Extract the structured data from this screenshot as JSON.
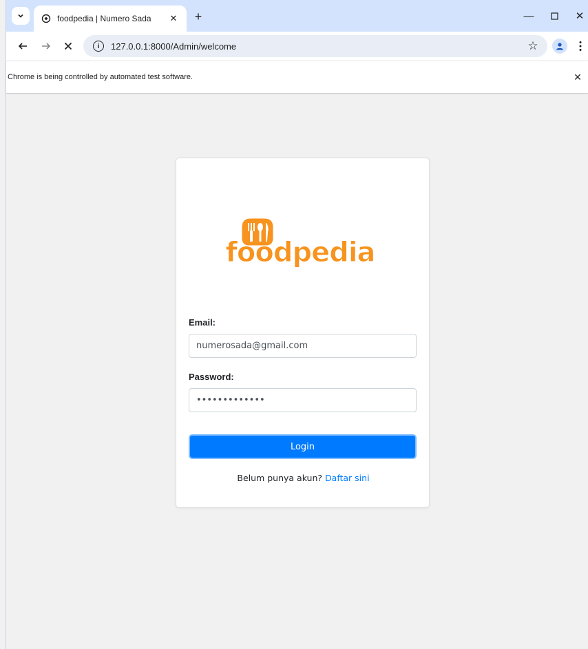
{
  "browser": {
    "tab_title": "foodpedia | Numero Sada",
    "url": "127.0.0.1:8000/Admin/welcome",
    "infobar_text": "Chrome is being controlled by automated test software."
  },
  "logo": {
    "text": "foodpedia",
    "colors": {
      "primary": "#f7931e",
      "accent": "#f15a24"
    }
  },
  "form": {
    "email_label": "Email:",
    "email_value": "numerosada@gmail.com",
    "password_label": "Password:",
    "password_value": "•••••••••••••",
    "login_label": "Login",
    "register_prompt": "Belum punya akun?",
    "register_link": "Daftar sini"
  },
  "colors": {
    "button": "#007bff",
    "link": "#007bff",
    "tabstrip": "#d3e3fd"
  }
}
